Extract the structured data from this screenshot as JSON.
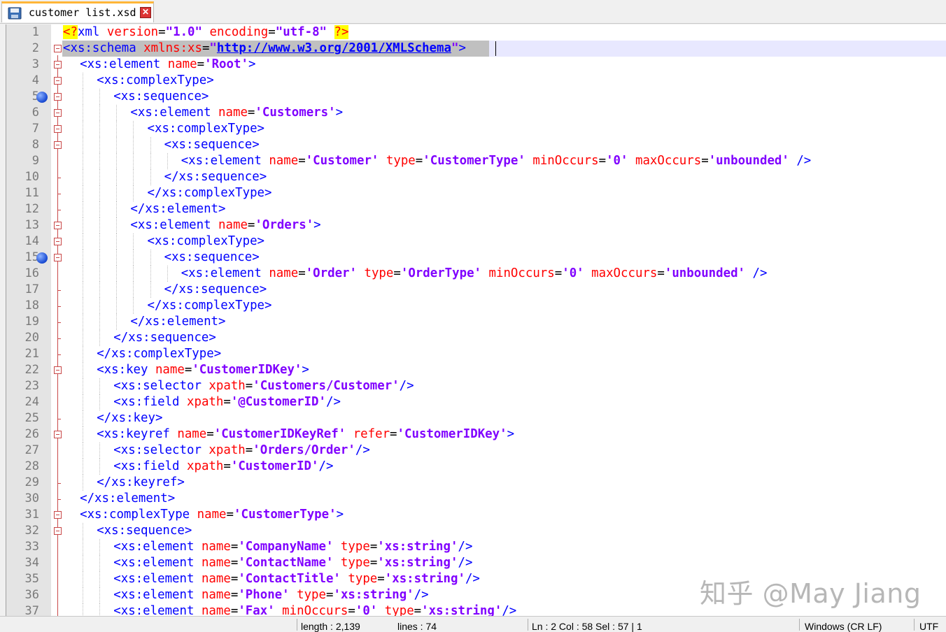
{
  "tab": {
    "label": "customer list.xsd",
    "close_symbol": "✕"
  },
  "lines": [
    {
      "n": "1",
      "indent": 0,
      "fold": "none",
      "tokens": [
        [
          "pi",
          "<?"
        ],
        [
          "tag",
          "xml "
        ],
        [
          "attr",
          "version"
        ],
        [
          "eq",
          "="
        ],
        [
          "dval",
          "\"1.0\""
        ],
        [
          "tag",
          " "
        ],
        [
          "attr",
          "encoding"
        ],
        [
          "eq",
          "="
        ],
        [
          "dval",
          "\"utf-8\""
        ],
        [
          "tag",
          " "
        ],
        [
          "pi",
          "?>"
        ]
      ]
    },
    {
      "n": "2",
      "indent": 0,
      "fold": "box",
      "current": true,
      "tokens": [
        [
          "tag",
          "<xs:schema "
        ],
        [
          "attr",
          "xmlns:xs"
        ],
        [
          "eq",
          "="
        ],
        [
          "dval",
          "\""
        ],
        [
          "url",
          "http://www.w3.org/2001/XMLSchema"
        ],
        [
          "dval",
          "\""
        ],
        [
          "tag",
          ">"
        ]
      ]
    },
    {
      "n": "3",
      "indent": 1,
      "fold": "box",
      "tokens": [
        [
          "tag",
          "<xs:element "
        ],
        [
          "attr",
          "name"
        ],
        [
          "eq",
          "="
        ],
        [
          "sval",
          "'Root'"
        ],
        [
          "tag",
          ">"
        ]
      ]
    },
    {
      "n": "4",
      "indent": 2,
      "fold": "box",
      "tokens": [
        [
          "tag",
          "<xs:complexType>"
        ]
      ]
    },
    {
      "n": "5",
      "indent": 3,
      "fold": "box",
      "bookmark": true,
      "tokens": [
        [
          "tag",
          "<xs:sequence>"
        ]
      ]
    },
    {
      "n": "6",
      "indent": 4,
      "fold": "box",
      "tokens": [
        [
          "tag",
          "<xs:element "
        ],
        [
          "attr",
          "name"
        ],
        [
          "eq",
          "="
        ],
        [
          "sval",
          "'Customers'"
        ],
        [
          "tag",
          ">"
        ]
      ]
    },
    {
      "n": "7",
      "indent": 5,
      "fold": "box",
      "tokens": [
        [
          "tag",
          "<xs:complexType>"
        ]
      ]
    },
    {
      "n": "8",
      "indent": 6,
      "fold": "box",
      "tokens": [
        [
          "tag",
          "<xs:sequence>"
        ]
      ]
    },
    {
      "n": "9",
      "indent": 7,
      "fold": "line",
      "tokens": [
        [
          "tag",
          "<xs:element "
        ],
        [
          "attr",
          "name"
        ],
        [
          "eq",
          "="
        ],
        [
          "sval",
          "'Customer'"
        ],
        [
          "tag",
          " "
        ],
        [
          "attr",
          "type"
        ],
        [
          "eq",
          "="
        ],
        [
          "sval",
          "'CustomerType'"
        ],
        [
          "tag",
          " "
        ],
        [
          "attr",
          "minOccurs"
        ],
        [
          "eq",
          "="
        ],
        [
          "sval",
          "'0'"
        ],
        [
          "tag",
          " "
        ],
        [
          "attr",
          "maxOccurs"
        ],
        [
          "eq",
          "="
        ],
        [
          "sval",
          "'unbounded'"
        ],
        [
          "tag",
          " />"
        ]
      ]
    },
    {
      "n": "10",
      "indent": 6,
      "fold": "tick",
      "tokens": [
        [
          "tag",
          "</xs:sequence>"
        ]
      ]
    },
    {
      "n": "11",
      "indent": 5,
      "fold": "tick",
      "tokens": [
        [
          "tag",
          "</xs:complexType>"
        ]
      ]
    },
    {
      "n": "12",
      "indent": 4,
      "fold": "tick",
      "tokens": [
        [
          "tag",
          "</xs:element>"
        ]
      ]
    },
    {
      "n": "13",
      "indent": 4,
      "fold": "box",
      "tokens": [
        [
          "tag",
          "<xs:element "
        ],
        [
          "attr",
          "name"
        ],
        [
          "eq",
          "="
        ],
        [
          "sval",
          "'Orders'"
        ],
        [
          "tag",
          ">"
        ]
      ]
    },
    {
      "n": "14",
      "indent": 5,
      "fold": "box",
      "tokens": [
        [
          "tag",
          "<xs:complexType>"
        ]
      ]
    },
    {
      "n": "15",
      "indent": 6,
      "fold": "box",
      "bookmark": true,
      "tokens": [
        [
          "tag",
          "<xs:sequence>"
        ]
      ]
    },
    {
      "n": "16",
      "indent": 7,
      "fold": "line",
      "tokens": [
        [
          "tag",
          "<xs:element "
        ],
        [
          "attr",
          "name"
        ],
        [
          "eq",
          "="
        ],
        [
          "sval",
          "'Order'"
        ],
        [
          "tag",
          " "
        ],
        [
          "attr",
          "type"
        ],
        [
          "eq",
          "="
        ],
        [
          "sval",
          "'OrderType'"
        ],
        [
          "tag",
          " "
        ],
        [
          "attr",
          "minOccurs"
        ],
        [
          "eq",
          "="
        ],
        [
          "sval",
          "'0'"
        ],
        [
          "tag",
          " "
        ],
        [
          "attr",
          "maxOccurs"
        ],
        [
          "eq",
          "="
        ],
        [
          "sval",
          "'unbounded'"
        ],
        [
          "tag",
          " />"
        ]
      ]
    },
    {
      "n": "17",
      "indent": 6,
      "fold": "tick",
      "tokens": [
        [
          "tag",
          "</xs:sequence>"
        ]
      ]
    },
    {
      "n": "18",
      "indent": 5,
      "fold": "tick",
      "tokens": [
        [
          "tag",
          "</xs:complexType>"
        ]
      ]
    },
    {
      "n": "19",
      "indent": 4,
      "fold": "tick",
      "tokens": [
        [
          "tag",
          "</xs:element>"
        ]
      ]
    },
    {
      "n": "20",
      "indent": 3,
      "fold": "tick",
      "tokens": [
        [
          "tag",
          "</xs:sequence>"
        ]
      ]
    },
    {
      "n": "21",
      "indent": 2,
      "fold": "tick",
      "tokens": [
        [
          "tag",
          "</xs:complexType>"
        ]
      ]
    },
    {
      "n": "22",
      "indent": 2,
      "fold": "box",
      "tokens": [
        [
          "tag",
          "<xs:key "
        ],
        [
          "attr",
          "name"
        ],
        [
          "eq",
          "="
        ],
        [
          "sval",
          "'CustomerIDKey'"
        ],
        [
          "tag",
          ">"
        ]
      ]
    },
    {
      "n": "23",
      "indent": 3,
      "fold": "line",
      "tokens": [
        [
          "tag",
          "<xs:selector "
        ],
        [
          "attr",
          "xpath"
        ],
        [
          "eq",
          "="
        ],
        [
          "sval",
          "'Customers/Customer'"
        ],
        [
          "tag",
          "/>"
        ]
      ]
    },
    {
      "n": "24",
      "indent": 3,
      "fold": "line",
      "tokens": [
        [
          "tag",
          "<xs:field "
        ],
        [
          "attr",
          "xpath"
        ],
        [
          "eq",
          "="
        ],
        [
          "sval",
          "'@CustomerID'"
        ],
        [
          "tag",
          "/>"
        ]
      ]
    },
    {
      "n": "25",
      "indent": 2,
      "fold": "tick",
      "tokens": [
        [
          "tag",
          "</xs:key>"
        ]
      ]
    },
    {
      "n": "26",
      "indent": 2,
      "fold": "box",
      "tokens": [
        [
          "tag",
          "<xs:keyref "
        ],
        [
          "attr",
          "name"
        ],
        [
          "eq",
          "="
        ],
        [
          "sval",
          "'CustomerIDKeyRef'"
        ],
        [
          "tag",
          " "
        ],
        [
          "attr",
          "refer"
        ],
        [
          "eq",
          "="
        ],
        [
          "sval",
          "'CustomerIDKey'"
        ],
        [
          "tag",
          ">"
        ]
      ]
    },
    {
      "n": "27",
      "indent": 3,
      "fold": "line",
      "tokens": [
        [
          "tag",
          "<xs:selector "
        ],
        [
          "attr",
          "xpath"
        ],
        [
          "eq",
          "="
        ],
        [
          "sval",
          "'Orders/Order'"
        ],
        [
          "tag",
          "/>"
        ]
      ]
    },
    {
      "n": "28",
      "indent": 3,
      "fold": "line",
      "tokens": [
        [
          "tag",
          "<xs:field "
        ],
        [
          "attr",
          "xpath"
        ],
        [
          "eq",
          "="
        ],
        [
          "sval",
          "'CustomerID'"
        ],
        [
          "tag",
          "/>"
        ]
      ]
    },
    {
      "n": "29",
      "indent": 2,
      "fold": "tick",
      "tokens": [
        [
          "tag",
          "</xs:keyref>"
        ]
      ]
    },
    {
      "n": "30",
      "indent": 1,
      "fold": "tick",
      "tokens": [
        [
          "tag",
          "</xs:element>"
        ]
      ]
    },
    {
      "n": "31",
      "indent": 1,
      "fold": "box",
      "tokens": [
        [
          "tag",
          "<xs:complexType "
        ],
        [
          "attr",
          "name"
        ],
        [
          "eq",
          "="
        ],
        [
          "sval",
          "'CustomerType'"
        ],
        [
          "tag",
          ">"
        ]
      ]
    },
    {
      "n": "32",
      "indent": 2,
      "fold": "box",
      "tokens": [
        [
          "tag",
          "<xs:sequence>"
        ]
      ]
    },
    {
      "n": "33",
      "indent": 3,
      "fold": "line",
      "tokens": [
        [
          "tag",
          "<xs:element "
        ],
        [
          "attr",
          "name"
        ],
        [
          "eq",
          "="
        ],
        [
          "sval",
          "'CompanyName'"
        ],
        [
          "tag",
          " "
        ],
        [
          "attr",
          "type"
        ],
        [
          "eq",
          "="
        ],
        [
          "sval",
          "'xs:string'"
        ],
        [
          "tag",
          "/>"
        ]
      ]
    },
    {
      "n": "34",
      "indent": 3,
      "fold": "line",
      "tokens": [
        [
          "tag",
          "<xs:element "
        ],
        [
          "attr",
          "name"
        ],
        [
          "eq",
          "="
        ],
        [
          "sval",
          "'ContactName'"
        ],
        [
          "tag",
          " "
        ],
        [
          "attr",
          "type"
        ],
        [
          "eq",
          "="
        ],
        [
          "sval",
          "'xs:string'"
        ],
        [
          "tag",
          "/>"
        ]
      ]
    },
    {
      "n": "35",
      "indent": 3,
      "fold": "line",
      "tokens": [
        [
          "tag",
          "<xs:element "
        ],
        [
          "attr",
          "name"
        ],
        [
          "eq",
          "="
        ],
        [
          "sval",
          "'ContactTitle'"
        ],
        [
          "tag",
          " "
        ],
        [
          "attr",
          "type"
        ],
        [
          "eq",
          "="
        ],
        [
          "sval",
          "'xs:string'"
        ],
        [
          "tag",
          "/>"
        ]
      ]
    },
    {
      "n": "36",
      "indent": 3,
      "fold": "line",
      "tokens": [
        [
          "tag",
          "<xs:element "
        ],
        [
          "attr",
          "name"
        ],
        [
          "eq",
          "="
        ],
        [
          "sval",
          "'Phone'"
        ],
        [
          "tag",
          " "
        ],
        [
          "attr",
          "type"
        ],
        [
          "eq",
          "="
        ],
        [
          "sval",
          "'xs:string'"
        ],
        [
          "tag",
          "/>"
        ]
      ]
    },
    {
      "n": "37",
      "indent": 3,
      "fold": "line",
      "tokens": [
        [
          "tag",
          "<xs:element "
        ],
        [
          "attr",
          "name"
        ],
        [
          "eq",
          "="
        ],
        [
          "sval",
          "'Fax'"
        ],
        [
          "tag",
          " "
        ],
        [
          "attr",
          "minOccurs"
        ],
        [
          "eq",
          "="
        ],
        [
          "sval",
          "'0'"
        ],
        [
          "tag",
          " "
        ],
        [
          "attr",
          "type"
        ],
        [
          "eq",
          "="
        ],
        [
          "sval",
          "'xs:string'"
        ],
        [
          "tag",
          "/>"
        ]
      ]
    }
  ],
  "statusbar": {
    "length": "length : 2,139",
    "lines": "lines : 74",
    "position": "Ln : 2    Col : 58    Sel : 57 | 1",
    "eol": "Windows (CR LF)",
    "encoding": "UTF"
  },
  "watermark": "知乎 @May Jiang",
  "colors": {
    "tag": "#0000ff",
    "attr": "#ff0000",
    "value": "#8000ff",
    "pi_background": "#ffff00",
    "fold_marker": "#c84848",
    "current_line": "#e8e8ff",
    "tab_accent": "#ffb638"
  }
}
